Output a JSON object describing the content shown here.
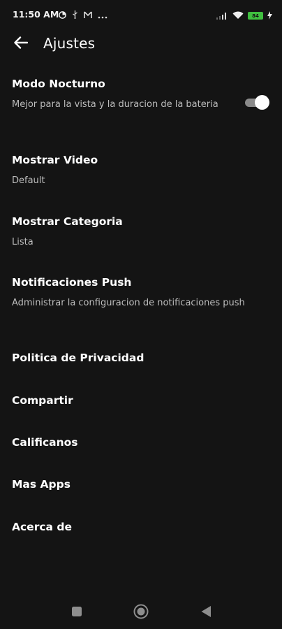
{
  "status_bar": {
    "time": "11:50 AM",
    "left_icons": [
      "data-saver-icon",
      "usb-icon",
      "mail-icon",
      "more-dots-icon"
    ],
    "right_icons": [
      "signal-icon",
      "wifi-icon",
      "battery-icon",
      "charging-icon"
    ],
    "battery_level": "84",
    "battery_color": "#3fbf3f"
  },
  "header": {
    "back_icon": "arrow-left-icon",
    "title": "Ajustes"
  },
  "settings": [
    {
      "id": "modo-nocturno",
      "title": "Modo Nocturno",
      "subtitle": "Mejor para la vista y la duracion de la bateria",
      "toggle": true,
      "toggle_on": true
    },
    {
      "id": "mostrar-video",
      "title": "Mostrar Video",
      "subtitle": "Default"
    },
    {
      "id": "mostrar-categoria",
      "title": "Mostrar Categoria",
      "subtitle": "Lista"
    },
    {
      "id": "notificaciones-push",
      "title": "Notificaciones Push",
      "subtitle": "Administrar la configuracion de notificaciones push"
    },
    {
      "id": "politica-privacidad",
      "title": "Politica de Privacidad"
    },
    {
      "id": "compartir",
      "title": "Compartir"
    },
    {
      "id": "calificanos",
      "title": "Calificanos"
    },
    {
      "id": "mas-apps",
      "title": "Mas Apps"
    },
    {
      "id": "acerca-de",
      "title": "Acerca de"
    }
  ],
  "nav_bar": {
    "icons": [
      "recents-square-icon",
      "home-circle-icon",
      "back-triangle-icon"
    ]
  },
  "colors": {
    "background": "#141414",
    "text_primary": "#ffffff",
    "text_secondary": "#bdbdbd"
  }
}
